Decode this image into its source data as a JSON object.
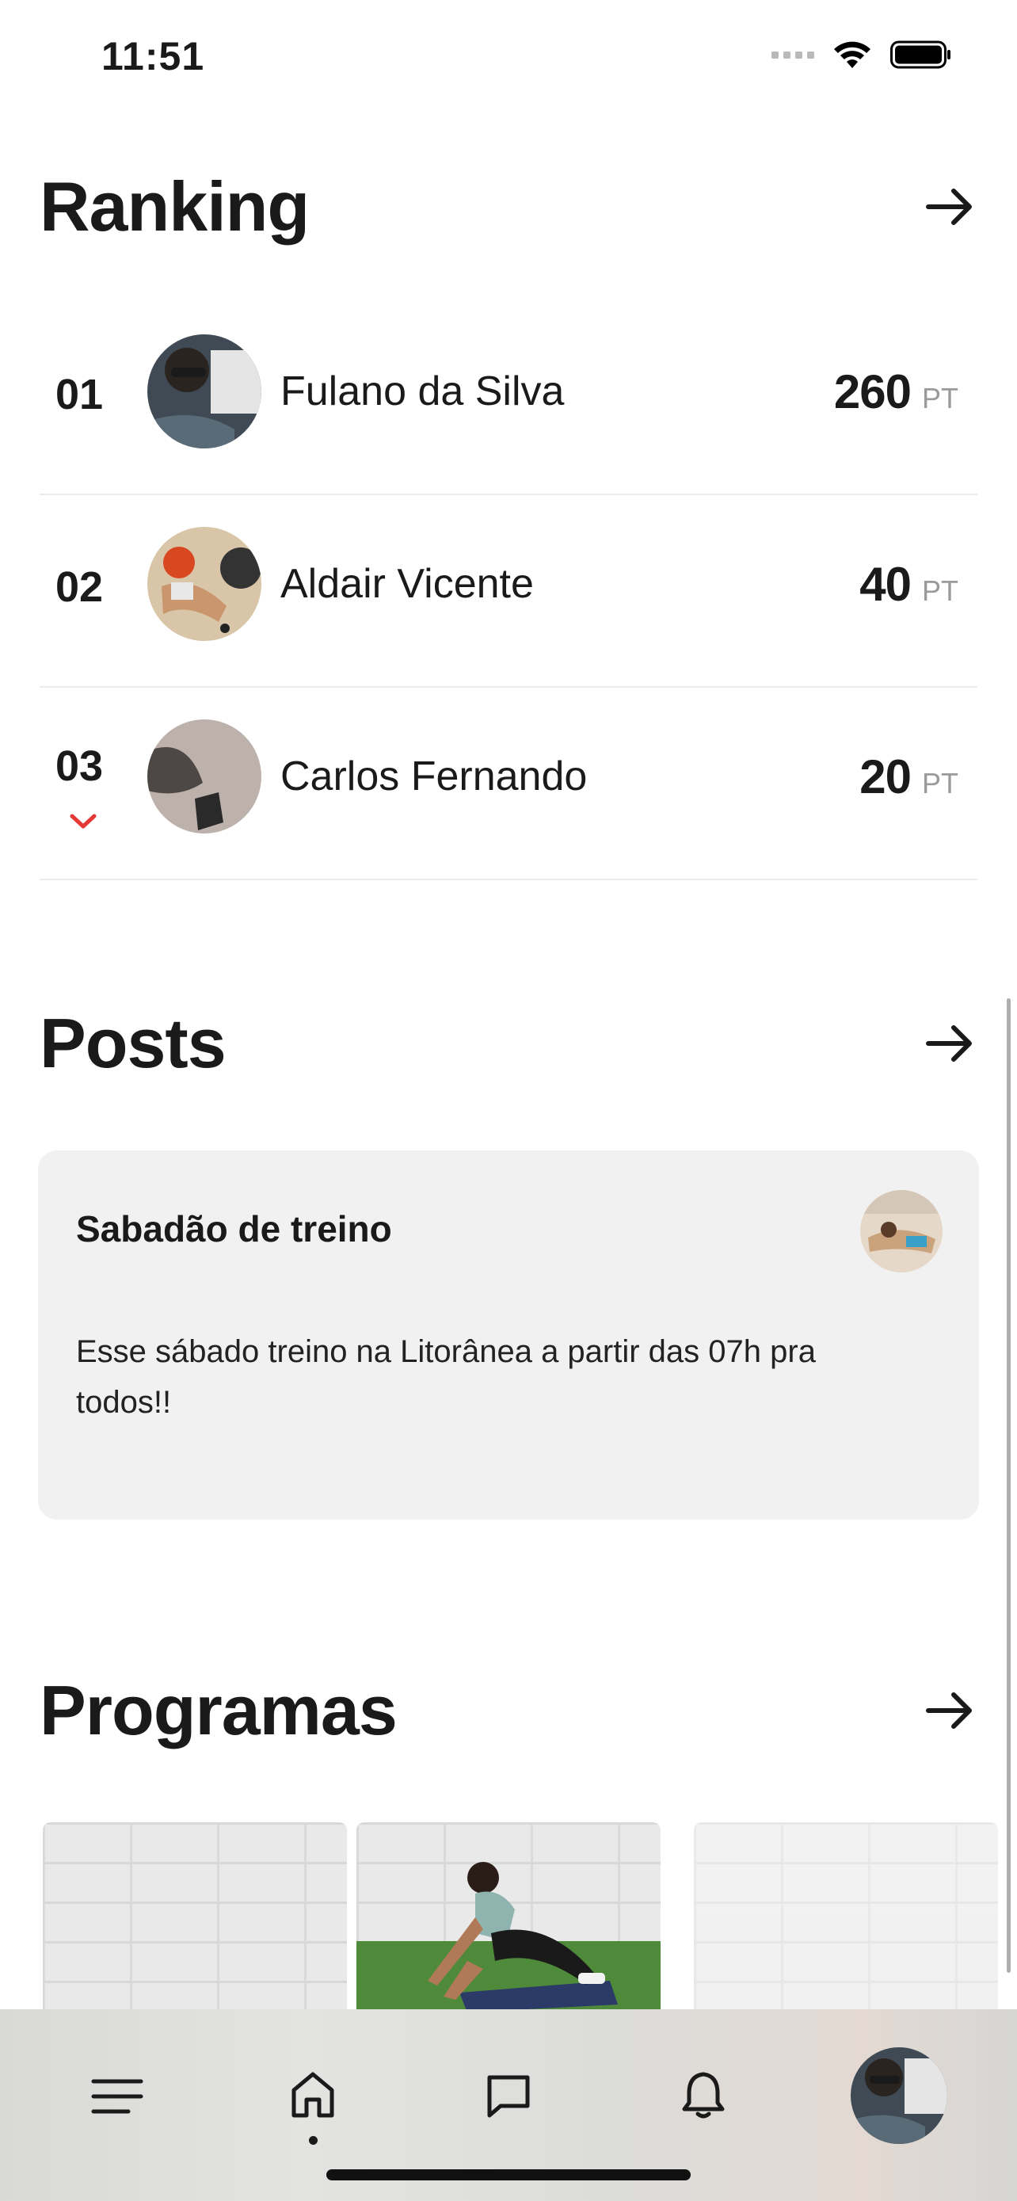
{
  "status_bar": {
    "time": "11:51"
  },
  "ranking": {
    "title": "Ranking",
    "rows": [
      {
        "position": "01",
        "name": "Fulano da Silva",
        "points": "260",
        "unit": "PT"
      },
      {
        "position": "02",
        "name": "Aldair Vicente",
        "points": "40",
        "unit": "PT"
      },
      {
        "position": "03",
        "name": "Carlos Fernando",
        "points": "20",
        "unit": "PT"
      }
    ]
  },
  "posts": {
    "title": "Posts",
    "card": {
      "title": "Sabadão de treino",
      "body": "Esse sábado treino na Litorânea a partir das 07h pra todos!!"
    }
  },
  "programs": {
    "title": "Programas"
  },
  "tab_bar": {
    "items": [
      {
        "icon": "menu-icon"
      },
      {
        "icon": "home-icon",
        "active": true
      },
      {
        "icon": "chat-icon"
      },
      {
        "icon": "bell-icon"
      },
      {
        "icon": "profile-avatar"
      }
    ]
  },
  "colors": {
    "accent_down": "#e53935",
    "card_bg": "#f1f1f1",
    "muted_text": "#9a9a9a"
  }
}
